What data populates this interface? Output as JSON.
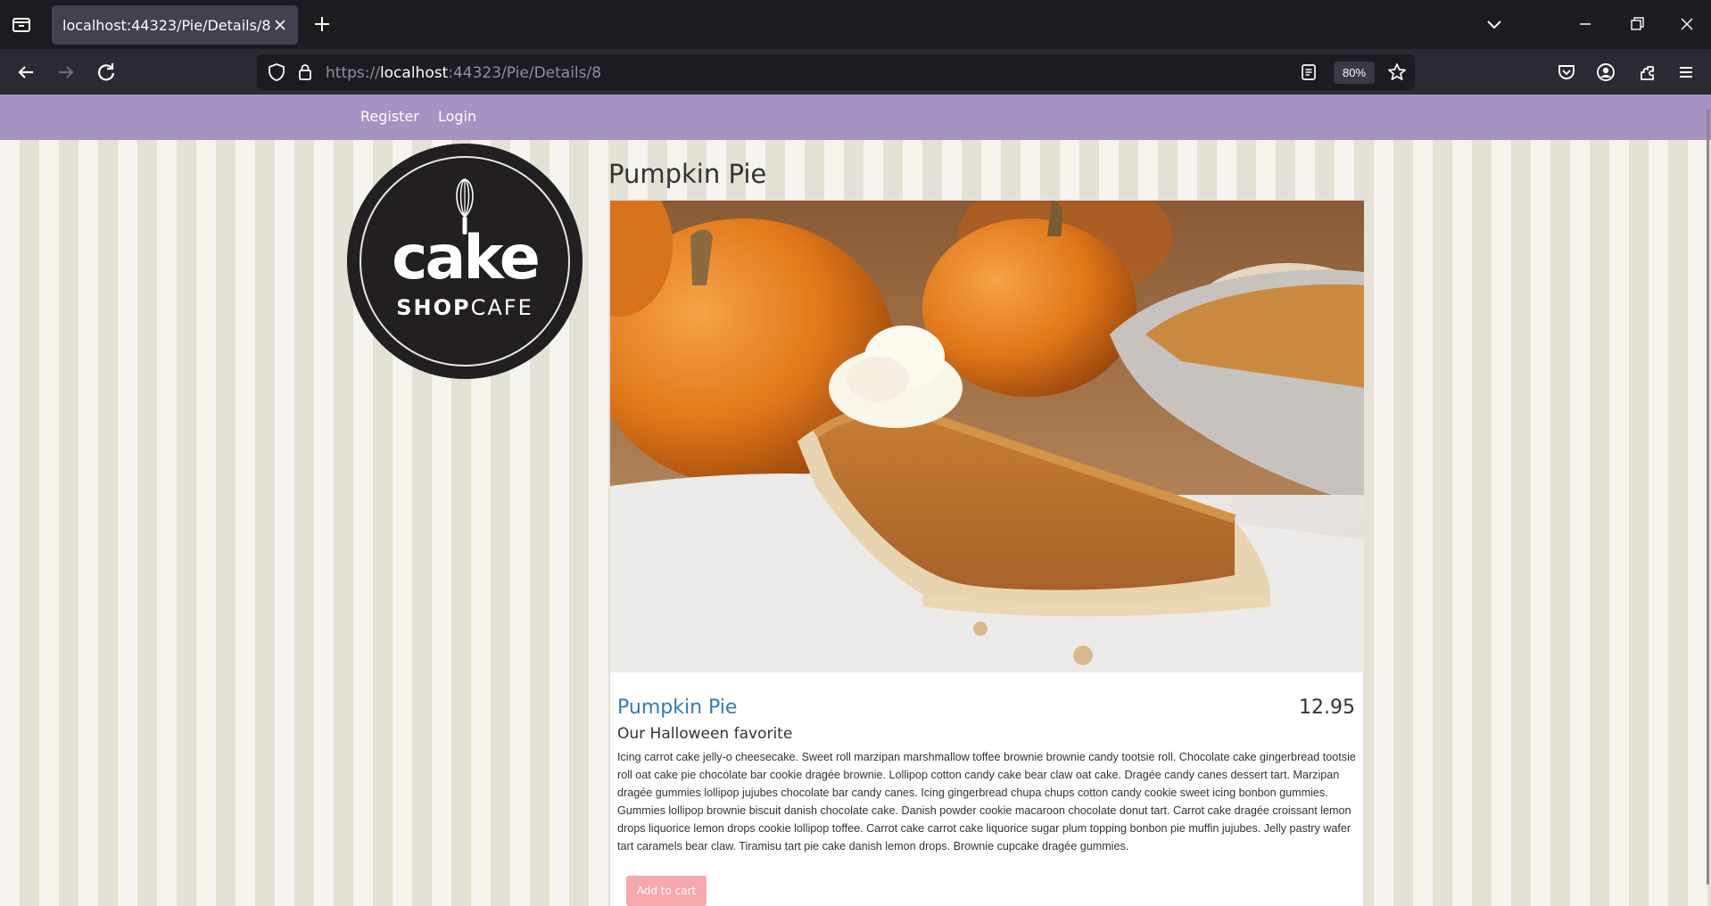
{
  "browser": {
    "tab_title": "localhost:44323/Pie/Details/8",
    "url_scheme": "https://",
    "url_host": "localhost",
    "url_path": ":44323/Pie/Details/8",
    "zoom": "80%",
    "icons": [
      "tab-list-icon",
      "close-icon",
      "plus-icon",
      "chevron-down-icon",
      "minimize-icon",
      "restore-icon",
      "close-window-icon",
      "back-arrow-icon",
      "forward-arrow-icon",
      "reload-icon",
      "shield-icon",
      "lock-icon",
      "reader-view-icon",
      "star-icon",
      "pocket-icon",
      "account-icon",
      "extensions-icon",
      "menu-icon"
    ]
  },
  "site_nav": {
    "register": "Register",
    "login": "Login",
    "background": "#a593c3"
  },
  "logo": {
    "word": "cake",
    "sub_bold": "SHOP",
    "sub_light": "CAFE"
  },
  "page": {
    "heading": "Pumpkin Pie"
  },
  "product": {
    "name": "Pumpkin Pie",
    "price": "12.95",
    "short_description": "Our Halloween favorite",
    "long_description": "Icing carrot cake jelly-o cheesecake. Sweet roll marzipan marshmallow toffee brownie brownie candy tootsie roll. Chocolate cake gingerbread tootsie roll oat cake pie chocolate bar cookie dragée brownie. Lollipop cotton candy cake bear claw oat cake. Dragée candy canes dessert tart. Marzipan dragée gummies lollipop jujubes chocolate bar candy canes. Icing gingerbread chupa chups cotton candy cookie sweet icing bonbon gummies. Gummies lollipop brownie biscuit danish chocolate cake. Danish powder cookie macaroon chocolate donut tart. Carrot cake dragée croissant lemon drops liquorice lemon drops cookie lollipop toffee. Carrot cake carrot cake liquorice sugar plum topping bonbon pie muffin jujubes. Jelly pastry wafer tart caramels bear claw. Tiramisu tart pie cake danish lemon drops. Brownie cupcake dragée gummies.",
    "add_to_cart": "Add to cart",
    "accent_color": "#337ab7",
    "button_color": "#f7a8ad"
  }
}
